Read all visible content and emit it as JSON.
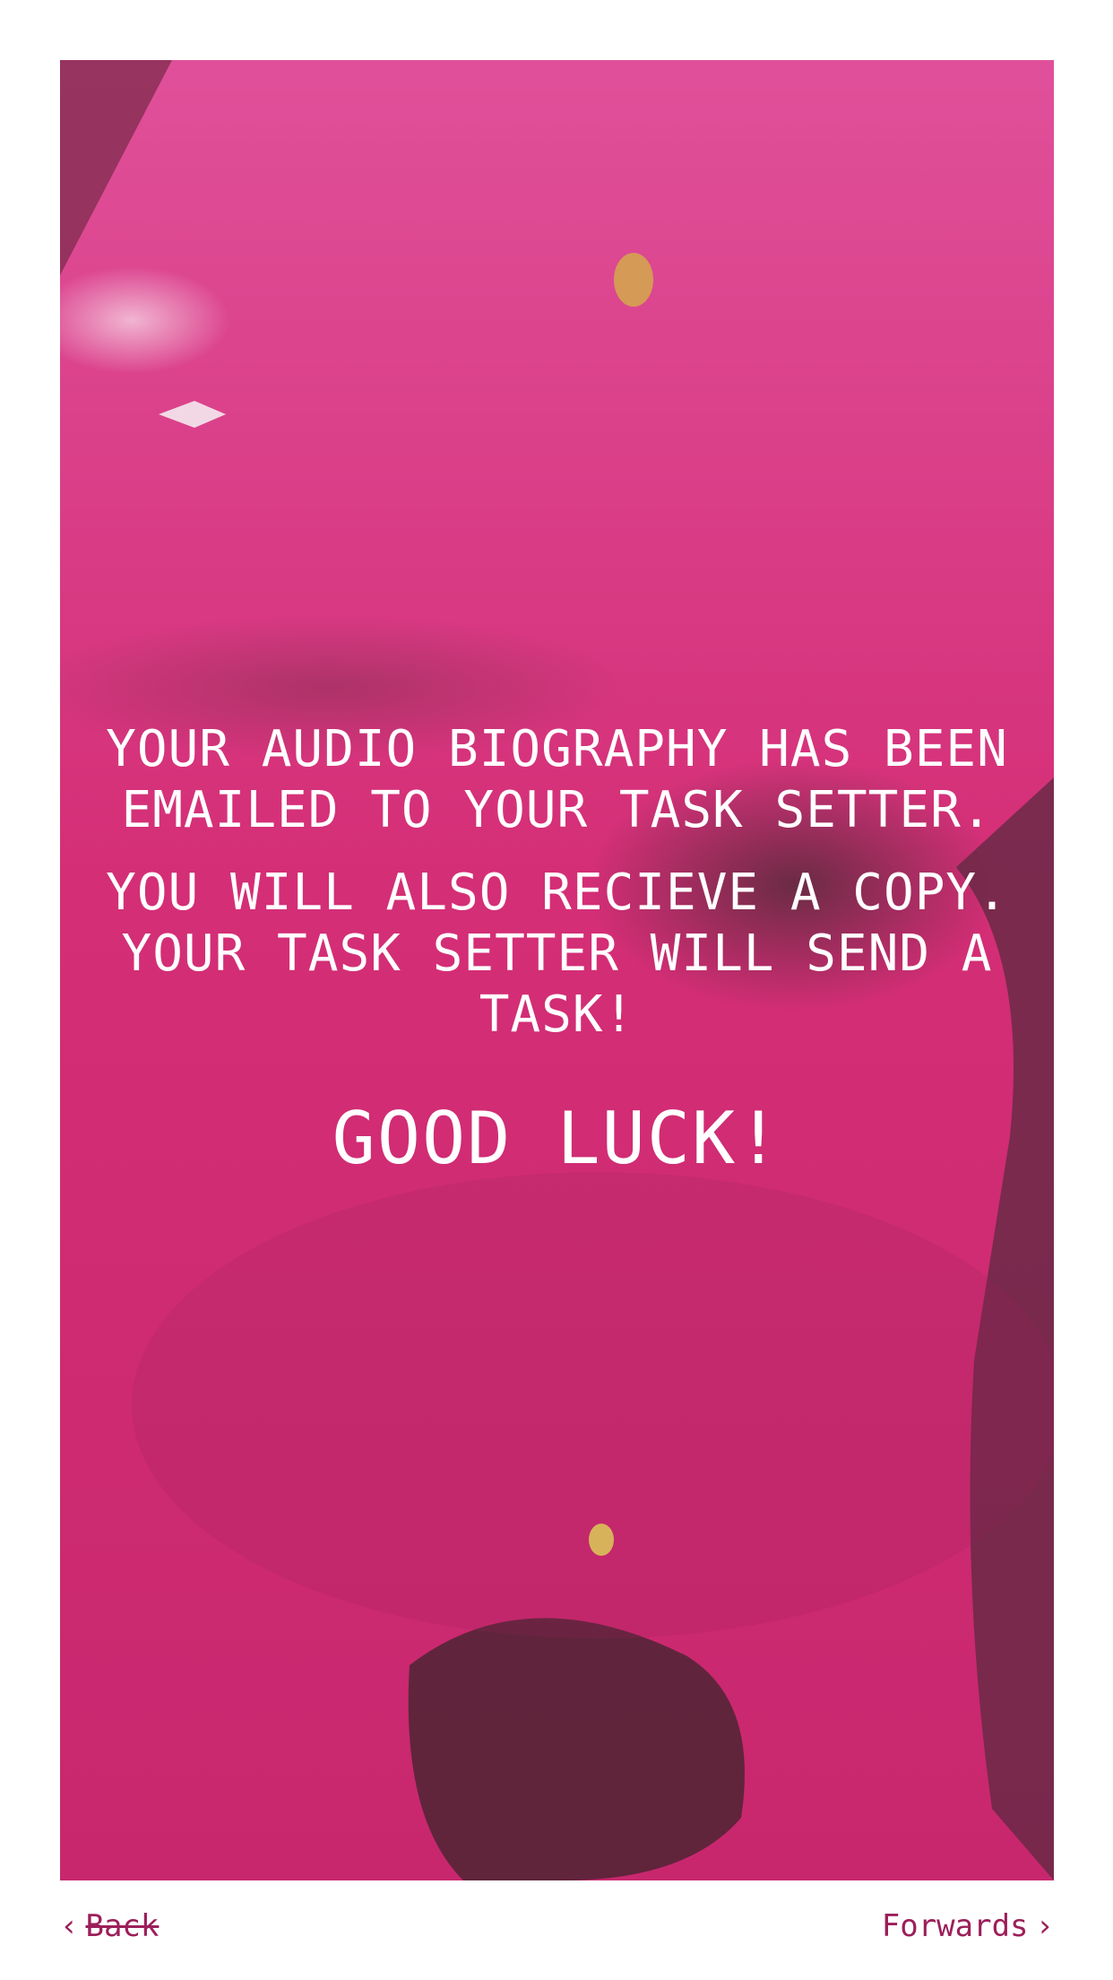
{
  "message": {
    "line1": "YOUR AUDIO BIOGRAPHY HAS BEEN EMAILED TO YOUR TASK SETTER.",
    "line2": "YOU WILL ALSO RECIEVE A COPY. YOUR TASK SETTER WILL SEND A TASK!",
    "closing": "GOOD LUCK!"
  },
  "nav": {
    "back_label": "Back",
    "forward_label": "Forwards",
    "back_icon": "chevron-left-icon",
    "forward_icon": "chevron-right-icon"
  },
  "colors": {
    "background_panel": "#d52a78",
    "nav_text": "#9c1f5a",
    "message_text": "#ffffff"
  }
}
